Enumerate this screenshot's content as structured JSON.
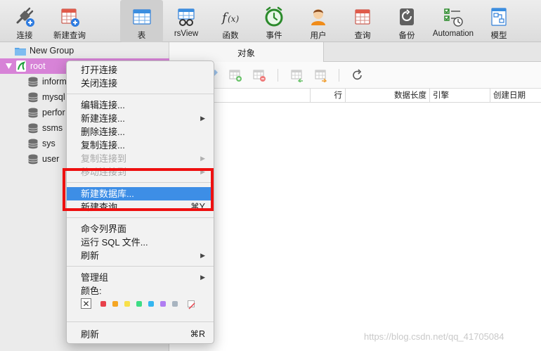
{
  "toolbar": {
    "items": [
      {
        "label": "连接"
      },
      {
        "label": "新建查询"
      },
      {
        "label": "表"
      },
      {
        "label": "rsView"
      },
      {
        "label": "函数"
      },
      {
        "label": "事件"
      },
      {
        "label": "用户"
      },
      {
        "label": "查询"
      },
      {
        "label": "备份"
      },
      {
        "label": "Automation"
      },
      {
        "label": "模型"
      }
    ],
    "active": "表"
  },
  "sidebar": {
    "group": "New Group",
    "connection": "root",
    "databases": [
      "inform",
      "mysql",
      "perfor",
      "ssms",
      "sys",
      "user"
    ]
  },
  "main": {
    "tab_label": "对象",
    "columns": [
      "行",
      "数据长度",
      "引擎",
      "创建日期"
    ]
  },
  "context_menu": {
    "items": [
      {
        "label": "打开连接"
      },
      {
        "label": "关闭连接"
      },
      {
        "label": "编辑连接..."
      },
      {
        "label": "新建连接...",
        "submenu": true
      },
      {
        "label": "删除连接..."
      },
      {
        "label": "复制连接..."
      },
      {
        "label": "复制连接到",
        "disabled": true,
        "submenu": true
      },
      {
        "label": "移动连接到",
        "disabled": true,
        "submenu": true
      },
      {
        "label": "新建数据库...",
        "highlighted": true
      },
      {
        "label": "新建查询",
        "shortcut": "⌘Y"
      },
      {
        "label": "命令列界面"
      },
      {
        "label": "运行 SQL 文件..."
      },
      {
        "label": "刷新",
        "submenu": true
      },
      {
        "label": "管理组",
        "submenu": true
      },
      {
        "label": "颜色:"
      },
      {
        "label": "刷新",
        "shortcut": "⌘R"
      }
    ],
    "colors": [
      "#e8414b",
      "#f5a623",
      "#f8e04a",
      "#3ddc84",
      "#35b6f0",
      "#b07df2",
      "#a8b4c0"
    ]
  },
  "watermark": "https://blog.csdn.net/qq_41705084"
}
